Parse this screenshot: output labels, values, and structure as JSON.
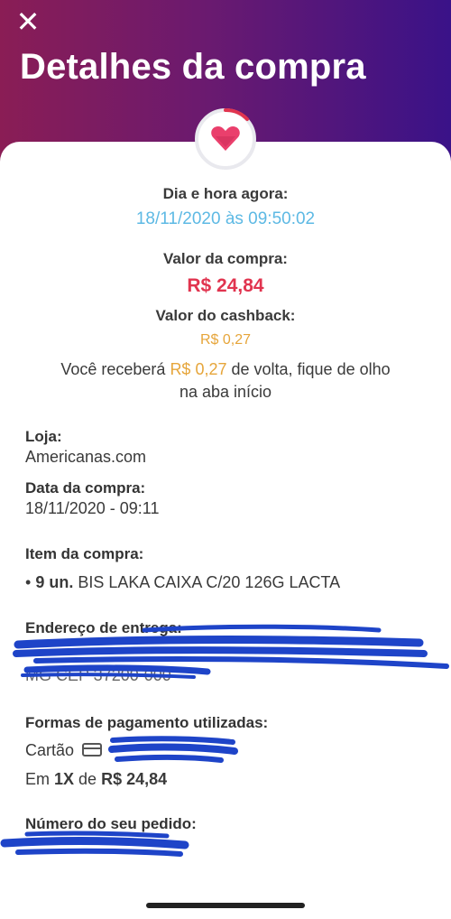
{
  "header": {
    "close_icon": "close-icon",
    "title": "Detalhes da compra",
    "gradient": [
      "#8a1d55",
      "#3a1288"
    ]
  },
  "summary": {
    "datetime_label": "Dia e hora agora:",
    "datetime_value": "18/11/2020 às 09:50:02",
    "purchase_label": "Valor da compra:",
    "purchase_value": "R$ 24,84",
    "cashback_label": "Valor do cashback:",
    "cashback_value": "R$ 0,27",
    "message_pre": "Você receberá ",
    "message_amount": "R$ 0,27",
    "message_post": " de volta, fique de olho",
    "message_line2": "na aba início"
  },
  "details": {
    "store_label": "Loja:",
    "store_value": "Americanas.com",
    "date_label": "Data da compra:",
    "date_value": "18/11/2020 - 09:11",
    "item_label": "Item da compra:",
    "item_qty": "9 un.",
    "item_name": " BIS LAKA CAIXA C/20 126G LACTA",
    "address_label": "Endereço de entrega:",
    "address_partial": "MG CEP 37200-000",
    "payment_label": "Formas de pagamento utilizadas:",
    "payment_method": "Cartão",
    "payment_icon": "credit-card-icon",
    "installments_pre": "Em ",
    "installments_count": "1X",
    "installments_mid": " de ",
    "installments_value": "R$ 24,84",
    "order_label": "Número do seu pedido:"
  },
  "colors": {
    "accent_blue": "#5db9e4",
    "accent_red": "#e1344f",
    "accent_gold": "#e6a53a",
    "redaction": "#1e44c8"
  }
}
